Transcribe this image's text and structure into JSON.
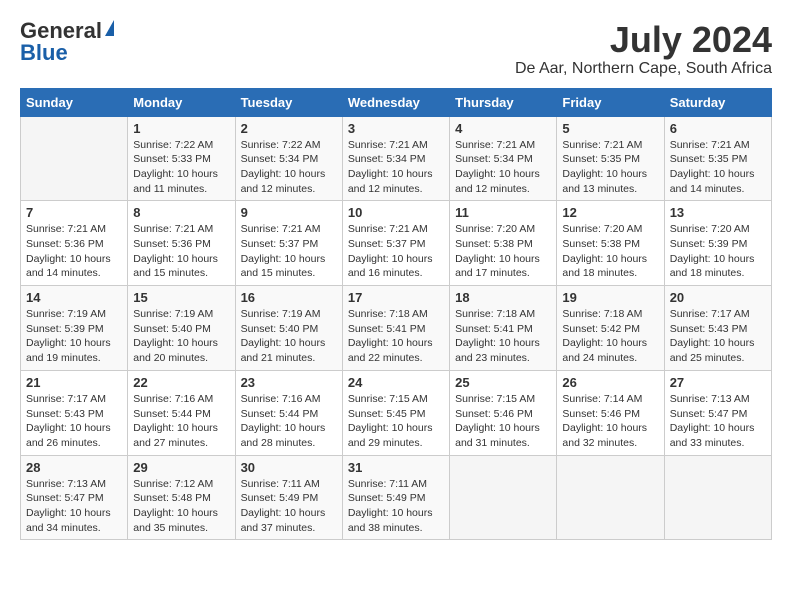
{
  "app": {
    "name_general": "General",
    "name_blue": "Blue"
  },
  "title": "July 2024",
  "location": "De Aar, Northern Cape, South Africa",
  "days_of_week": [
    "Sunday",
    "Monday",
    "Tuesday",
    "Wednesday",
    "Thursday",
    "Friday",
    "Saturday"
  ],
  "weeks": [
    [
      {
        "day": "",
        "info": ""
      },
      {
        "day": "1",
        "info": "Sunrise: 7:22 AM\nSunset: 5:33 PM\nDaylight: 10 hours\nand 11 minutes."
      },
      {
        "day": "2",
        "info": "Sunrise: 7:22 AM\nSunset: 5:34 PM\nDaylight: 10 hours\nand 12 minutes."
      },
      {
        "day": "3",
        "info": "Sunrise: 7:21 AM\nSunset: 5:34 PM\nDaylight: 10 hours\nand 12 minutes."
      },
      {
        "day": "4",
        "info": "Sunrise: 7:21 AM\nSunset: 5:34 PM\nDaylight: 10 hours\nand 12 minutes."
      },
      {
        "day": "5",
        "info": "Sunrise: 7:21 AM\nSunset: 5:35 PM\nDaylight: 10 hours\nand 13 minutes."
      },
      {
        "day": "6",
        "info": "Sunrise: 7:21 AM\nSunset: 5:35 PM\nDaylight: 10 hours\nand 14 minutes."
      }
    ],
    [
      {
        "day": "7",
        "info": "Sunrise: 7:21 AM\nSunset: 5:36 PM\nDaylight: 10 hours\nand 14 minutes."
      },
      {
        "day": "8",
        "info": "Sunrise: 7:21 AM\nSunset: 5:36 PM\nDaylight: 10 hours\nand 15 minutes."
      },
      {
        "day": "9",
        "info": "Sunrise: 7:21 AM\nSunset: 5:37 PM\nDaylight: 10 hours\nand 15 minutes."
      },
      {
        "day": "10",
        "info": "Sunrise: 7:21 AM\nSunset: 5:37 PM\nDaylight: 10 hours\nand 16 minutes."
      },
      {
        "day": "11",
        "info": "Sunrise: 7:20 AM\nSunset: 5:38 PM\nDaylight: 10 hours\nand 17 minutes."
      },
      {
        "day": "12",
        "info": "Sunrise: 7:20 AM\nSunset: 5:38 PM\nDaylight: 10 hours\nand 18 minutes."
      },
      {
        "day": "13",
        "info": "Sunrise: 7:20 AM\nSunset: 5:39 PM\nDaylight: 10 hours\nand 18 minutes."
      }
    ],
    [
      {
        "day": "14",
        "info": "Sunrise: 7:19 AM\nSunset: 5:39 PM\nDaylight: 10 hours\nand 19 minutes."
      },
      {
        "day": "15",
        "info": "Sunrise: 7:19 AM\nSunset: 5:40 PM\nDaylight: 10 hours\nand 20 minutes."
      },
      {
        "day": "16",
        "info": "Sunrise: 7:19 AM\nSunset: 5:40 PM\nDaylight: 10 hours\nand 21 minutes."
      },
      {
        "day": "17",
        "info": "Sunrise: 7:18 AM\nSunset: 5:41 PM\nDaylight: 10 hours\nand 22 minutes."
      },
      {
        "day": "18",
        "info": "Sunrise: 7:18 AM\nSunset: 5:41 PM\nDaylight: 10 hours\nand 23 minutes."
      },
      {
        "day": "19",
        "info": "Sunrise: 7:18 AM\nSunset: 5:42 PM\nDaylight: 10 hours\nand 24 minutes."
      },
      {
        "day": "20",
        "info": "Sunrise: 7:17 AM\nSunset: 5:43 PM\nDaylight: 10 hours\nand 25 minutes."
      }
    ],
    [
      {
        "day": "21",
        "info": "Sunrise: 7:17 AM\nSunset: 5:43 PM\nDaylight: 10 hours\nand 26 minutes."
      },
      {
        "day": "22",
        "info": "Sunrise: 7:16 AM\nSunset: 5:44 PM\nDaylight: 10 hours\nand 27 minutes."
      },
      {
        "day": "23",
        "info": "Sunrise: 7:16 AM\nSunset: 5:44 PM\nDaylight: 10 hours\nand 28 minutes."
      },
      {
        "day": "24",
        "info": "Sunrise: 7:15 AM\nSunset: 5:45 PM\nDaylight: 10 hours\nand 29 minutes."
      },
      {
        "day": "25",
        "info": "Sunrise: 7:15 AM\nSunset: 5:46 PM\nDaylight: 10 hours\nand 31 minutes."
      },
      {
        "day": "26",
        "info": "Sunrise: 7:14 AM\nSunset: 5:46 PM\nDaylight: 10 hours\nand 32 minutes."
      },
      {
        "day": "27",
        "info": "Sunrise: 7:13 AM\nSunset: 5:47 PM\nDaylight: 10 hours\nand 33 minutes."
      }
    ],
    [
      {
        "day": "28",
        "info": "Sunrise: 7:13 AM\nSunset: 5:47 PM\nDaylight: 10 hours\nand 34 minutes."
      },
      {
        "day": "29",
        "info": "Sunrise: 7:12 AM\nSunset: 5:48 PM\nDaylight: 10 hours\nand 35 minutes."
      },
      {
        "day": "30",
        "info": "Sunrise: 7:11 AM\nSunset: 5:49 PM\nDaylight: 10 hours\nand 37 minutes."
      },
      {
        "day": "31",
        "info": "Sunrise: 7:11 AM\nSunset: 5:49 PM\nDaylight: 10 hours\nand 38 minutes."
      },
      {
        "day": "",
        "info": ""
      },
      {
        "day": "",
        "info": ""
      },
      {
        "day": "",
        "info": ""
      }
    ]
  ]
}
